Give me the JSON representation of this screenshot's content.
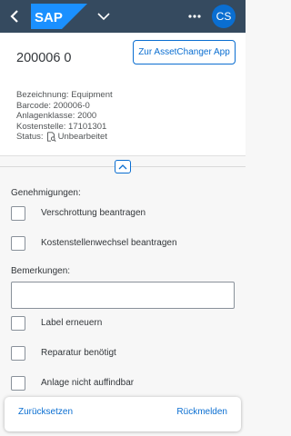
{
  "shell": {
    "logo_text": "SAP",
    "avatar_initials": "CS",
    "colors": {
      "bar": "#354a5f",
      "logo": "#1b90ff",
      "avatar": "#0a6ed1"
    },
    "icons": [
      "back-icon",
      "sap-logo",
      "chevron-down-icon",
      "more-icon"
    ]
  },
  "header": {
    "title": "200006 0",
    "action_button": "Zur AssetChanger App",
    "attributes": {
      "bezeichnung": "Bezeichnung: Equipment",
      "barcode": "Barcode: 200006-0",
      "anlagenklasse": "Anlagenklasse: 2000",
      "kostenstelle": "Kostenstelle: 17101301",
      "status_label": "Status:",
      "status_value": "Unbearbeitet"
    }
  },
  "form": {
    "approvals_label": "Genehmigungen:",
    "approvals": [
      {
        "label": "Verschrottung beantragen",
        "checked": false
      },
      {
        "label": "Kostenstellenwechsel beantragen",
        "checked": false
      }
    ],
    "remarks_label": "Bemerkungen:",
    "remarks_value": "",
    "flags": [
      {
        "label": "Label erneuern",
        "checked": false
      },
      {
        "label": "Reparatur benötigt",
        "checked": false
      },
      {
        "label": "Anlage nicht auffindbar",
        "checked": false
      }
    ]
  },
  "footer": {
    "reset_label": "Zurücksetzen",
    "submit_label": "Rückmelden"
  }
}
